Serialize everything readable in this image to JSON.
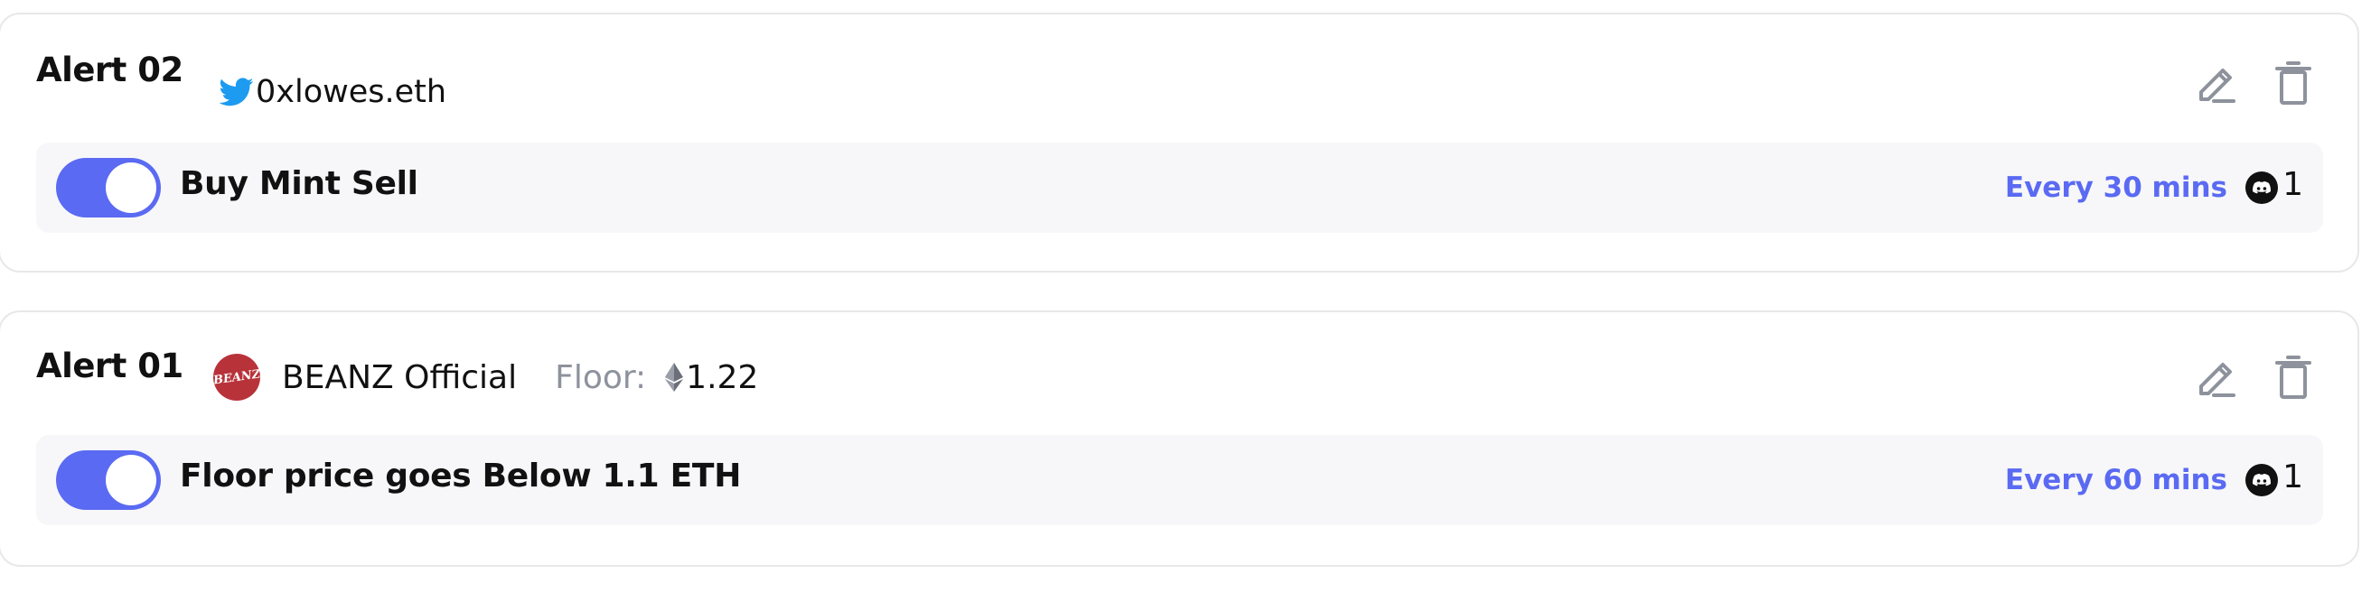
{
  "alerts": [
    {
      "title": "Alert 02",
      "source_type": "twitter",
      "source_icon": "twitter-icon",
      "handle": "0xlowes.eth",
      "rule": "Buy Mint Sell",
      "enabled": true,
      "frequency": "Every 30 mins",
      "channel_icon": "discord-icon",
      "channel_count": "1"
    },
    {
      "title": "Alert 01",
      "source_type": "collection",
      "avatar_text": "BEANZ",
      "collection_name": "BEANZ Official",
      "floor_label": "Floor:",
      "floor_currency_icon": "eth-icon",
      "floor_value": "1.22",
      "rule": "Floor price goes Below 1.1 ETH",
      "enabled": true,
      "frequency": "Every 60 mins",
      "channel_icon": "discord-icon",
      "channel_count": "1"
    }
  ],
  "actions": {
    "edit_icon": "edit-pencil-icon",
    "delete_icon": "trash-icon"
  },
  "colors": {
    "accent": "#5a6af2",
    "twitter": "#1d9bf0",
    "muted": "#8d929c",
    "rule_bg": "#f7f7f9",
    "border": "#e8e8ea"
  }
}
